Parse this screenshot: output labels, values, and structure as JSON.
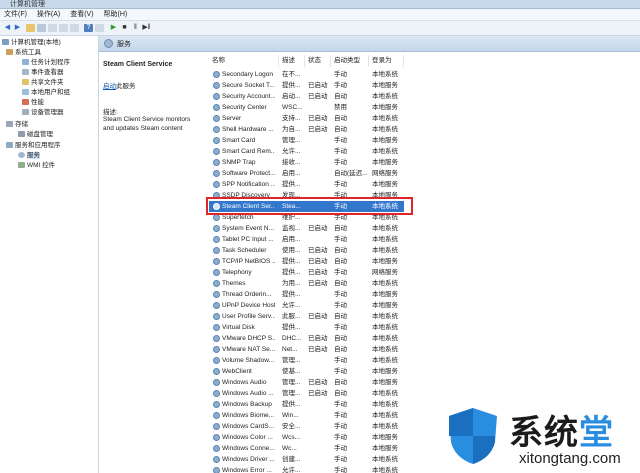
{
  "window": {
    "title": "计算机管理"
  },
  "menu": [
    "文件(F)",
    "操作(A)",
    "查看(V)",
    "帮助(H)"
  ],
  "tree": [
    {
      "label": "计算机管理(本地)",
      "indent": 0
    },
    {
      "label": "系统工具",
      "indent": 1
    },
    {
      "label": "任务计划程序",
      "indent": 2
    },
    {
      "label": "事件查看器",
      "indent": 2
    },
    {
      "label": "共享文件夹",
      "indent": 2
    },
    {
      "label": "本地用户和组",
      "indent": 2
    },
    {
      "label": "性能",
      "indent": 2
    },
    {
      "label": "设备管理器",
      "indent": 2
    },
    {
      "label": "存储",
      "indent": 1
    },
    {
      "label": "磁盘管理",
      "indent": 2
    },
    {
      "label": "服务和应用程序",
      "indent": 1
    },
    {
      "label": "服务",
      "indent": 2,
      "selected": true
    },
    {
      "label": "WMI 控件",
      "indent": 2
    }
  ],
  "header": {
    "title": "服务"
  },
  "detail": {
    "service_name": "Steam Client Service",
    "link_action": "启动",
    "link_suffix": "此服务",
    "desc_label": "描述:",
    "desc_text": "Steam Client Service monitors and updates Steam content"
  },
  "columns": [
    "名称",
    "描述",
    "状态",
    "启动类型",
    "登录为"
  ],
  "services": [
    [
      "Secondary Logon",
      "在不...",
      "",
      "手动",
      "本地系统"
    ],
    [
      "Secure Socket T...",
      "提供...",
      "已启动",
      "手动",
      "本地服务"
    ],
    [
      "Security Account...",
      "启动...",
      "已启动",
      "自动",
      "本地系统"
    ],
    [
      "Security Center",
      "WSC...",
      "",
      "禁用",
      "本地服务"
    ],
    [
      "Server",
      "支持...",
      "已启动",
      "自动",
      "本地系统"
    ],
    [
      "Shell Hardware ...",
      "为自...",
      "已启动",
      "自动",
      "本地系统"
    ],
    [
      "Smart Card",
      "管理...",
      "",
      "手动",
      "本地服务"
    ],
    [
      "Smart Card Rem...",
      "允许...",
      "",
      "手动",
      "本地系统"
    ],
    [
      "SNMP Trap",
      "接收...",
      "",
      "手动",
      "本地服务"
    ],
    [
      "Software Protect...",
      "启用...",
      "",
      "自动(延迟...",
      "网络服务"
    ],
    [
      "SPP Notification ...",
      "提供...",
      "",
      "手动",
      "本地服务"
    ],
    [
      "SSDP Discovery",
      "发现...",
      "",
      "手动",
      "本地服务"
    ],
    [
      "Steam Client Ser...",
      "Stea...",
      "",
      "手动",
      "本地系统"
    ],
    [
      "Superfetch",
      "维护...",
      "",
      "手动",
      "本地系统"
    ],
    [
      "System Event N...",
      "监视...",
      "已启动",
      "自动",
      "本地系统"
    ],
    [
      "Tablet PC Input ...",
      "启用...",
      "",
      "手动",
      "本地系统"
    ],
    [
      "Task Scheduler",
      "使用...",
      "已启动",
      "自动",
      "本地系统"
    ],
    [
      "TCP/IP NetBIOS ...",
      "提供...",
      "已启动",
      "自动",
      "本地服务"
    ],
    [
      "Telephony",
      "提供...",
      "已启动",
      "手动",
      "网络服务"
    ],
    [
      "Themes",
      "为用...",
      "已启动",
      "自动",
      "本地系统"
    ],
    [
      "Thread Orderin...",
      "提供...",
      "",
      "手动",
      "本地服务"
    ],
    [
      "UPnP Device Host",
      "允许...",
      "",
      "手动",
      "本地服务"
    ],
    [
      "User Profile Serv...",
      "此服...",
      "已启动",
      "自动",
      "本地系统"
    ],
    [
      "Virtual Disk",
      "提供...",
      "",
      "手动",
      "本地系统"
    ],
    [
      "VMware DHCP S...",
      "DHC...",
      "已启动",
      "自动",
      "本地系统"
    ],
    [
      "VMware NAT Se...",
      "Net...",
      "已启动",
      "自动",
      "本地系统"
    ],
    [
      "Volume Shadow...",
      "管理...",
      "",
      "手动",
      "本地系统"
    ],
    [
      "WebClient",
      "使基...",
      "",
      "手动",
      "本地服务"
    ],
    [
      "Windows Audio",
      "管理...",
      "已启动",
      "自动",
      "本地服务"
    ],
    [
      "Windows Audio ...",
      "管理...",
      "已启动",
      "自动",
      "本地系统"
    ],
    [
      "Windows Backup",
      "提供...",
      "",
      "手动",
      "本地系统"
    ],
    [
      "Windows Biome...",
      "Win...",
      "",
      "手动",
      "本地系统"
    ],
    [
      "Windows CardS...",
      "安全...",
      "",
      "手动",
      "本地系统"
    ],
    [
      "Windows Color ...",
      "Wcs...",
      "",
      "手动",
      "本地服务"
    ],
    [
      "Windows Conne...",
      "Wc...",
      "",
      "手动",
      "本地服务"
    ],
    [
      "Windows Driver ...",
      "创建...",
      "",
      "手动",
      "本地系统"
    ],
    [
      "Windows Error ...",
      "允许...",
      "",
      "手动",
      "本地系统"
    ]
  ],
  "selected_index": 12,
  "watermark": {
    "text": "系统",
    "accent": "堂",
    "sub": "xitongtang.com"
  },
  "colors": {
    "selection": "#3377cc",
    "highlight_box": "#e0242a",
    "accent": "#2a8ee0"
  }
}
